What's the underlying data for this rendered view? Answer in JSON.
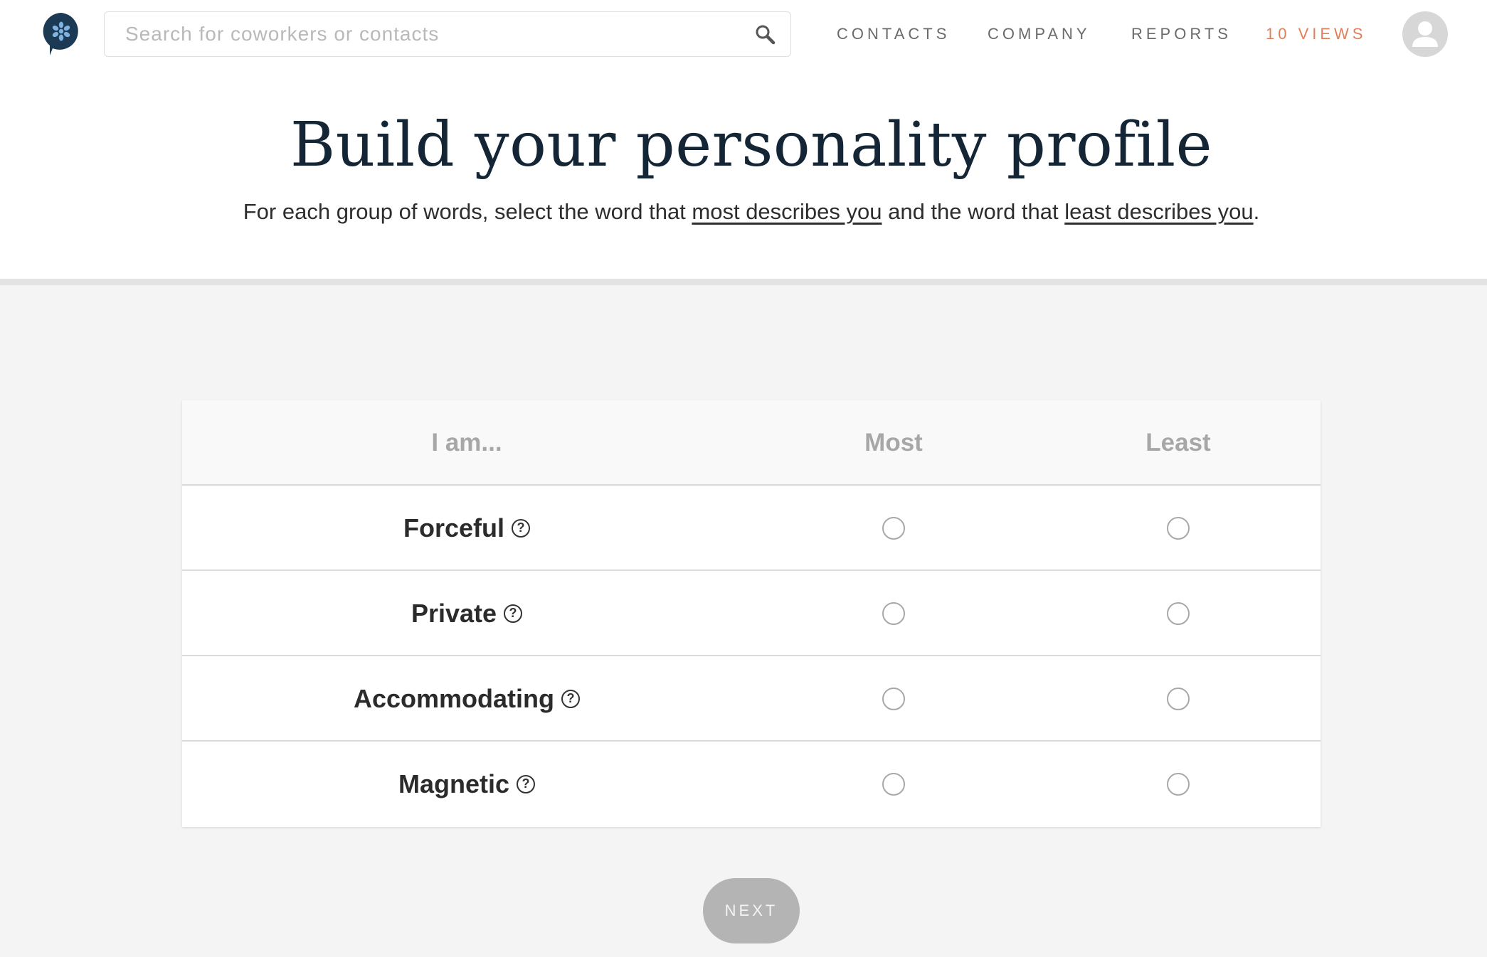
{
  "header": {
    "search": {
      "placeholder": "Search for coworkers or contacts",
      "value": ""
    },
    "nav": [
      {
        "label": "CONTACTS"
      },
      {
        "label": "COMPANY"
      },
      {
        "label": "REPORTS"
      },
      {
        "label": "10 VIEWS"
      }
    ],
    "accent_color": "#e0805a",
    "logo_icon": "flower-chat-bubble-logo",
    "avatar_icon": "user-avatar-icon"
  },
  "hero": {
    "title": "Build your personality profile",
    "subtitle_part1": "For each group of words, select the word that ",
    "subtitle_link1": "most describes you",
    "subtitle_part2": " and the word that ",
    "subtitle_link2": "least describes you",
    "subtitle_part3": "."
  },
  "table": {
    "columns": [
      "I am...",
      "Most",
      "Least"
    ],
    "rows": [
      {
        "word": "Forceful",
        "most_selected": false,
        "least_selected": false
      },
      {
        "word": "Private",
        "most_selected": false,
        "least_selected": false
      },
      {
        "word": "Accommodating",
        "most_selected": false,
        "least_selected": false
      },
      {
        "word": "Magnetic",
        "most_selected": false,
        "least_selected": false
      }
    ],
    "help_icon": "question-circle-icon"
  },
  "footer": {
    "next_label": "NEXT"
  }
}
